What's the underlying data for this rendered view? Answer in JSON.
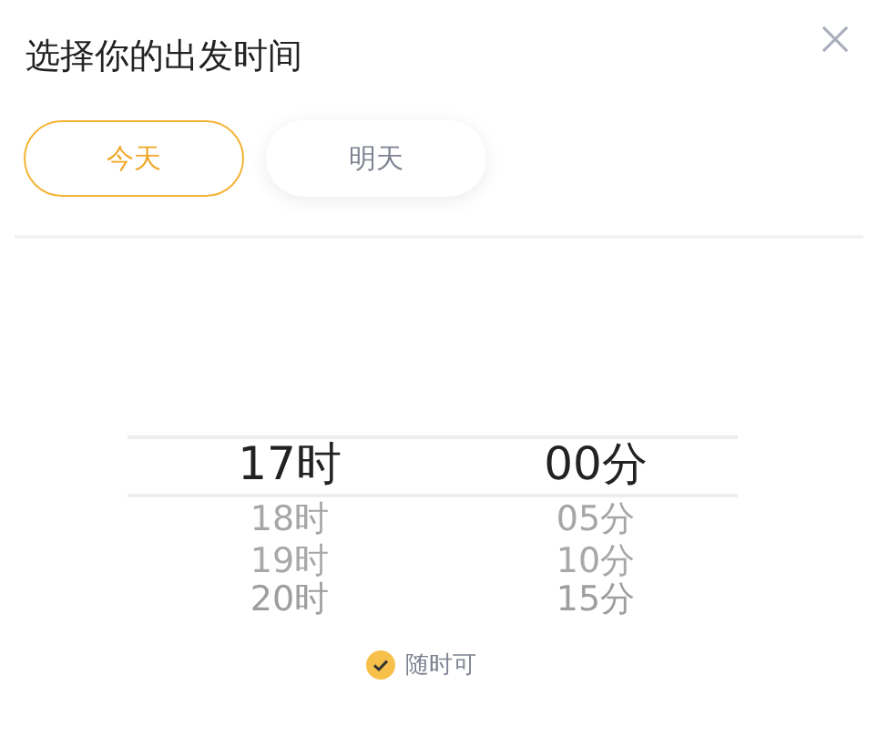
{
  "title": "选择你的出发时间",
  "tabs": [
    {
      "label": "今天",
      "selected": true
    },
    {
      "label": "明天",
      "selected": false
    }
  ],
  "picker": {
    "columns": [
      {
        "items": [
          {
            "label": "17时",
            "selected": true
          },
          {
            "label": "18时",
            "selected": false
          },
          {
            "label": "19时",
            "selected": false
          },
          {
            "label": "20时",
            "selected": false
          }
        ]
      },
      {
        "items": [
          {
            "label": "00分",
            "selected": true
          },
          {
            "label": "05分",
            "selected": false
          },
          {
            "label": "10分",
            "selected": false
          },
          {
            "label": "15分",
            "selected": false
          }
        ]
      }
    ]
  },
  "anytime": {
    "label": "随时可",
    "checked": true
  }
}
